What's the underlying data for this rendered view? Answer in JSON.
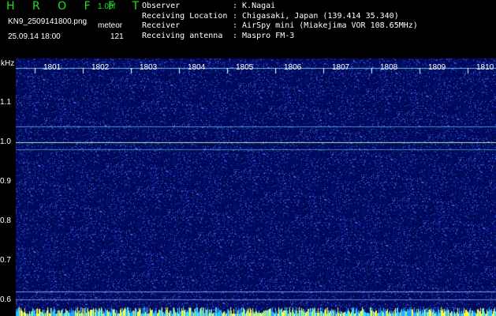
{
  "header": {
    "app": "H R O F F T",
    "version": "1.00f",
    "filename": "KN9_2509141800.png",
    "mode": "meteor",
    "datetime": "25.09.14 18:00",
    "count": "121",
    "meta": [
      {
        "key": "Observer",
        "value": ": K.Nagai"
      },
      {
        "key": "Receiving Location",
        "value": ": Chigasaki, Japan (139.414 35.340)"
      },
      {
        "key": "Receiver",
        "value": ": AirSpy mini (Miakejima VOR 108.65MHz)"
      },
      {
        "key": "Receiving antenna",
        "value": ": Maspro FM-3"
      }
    ]
  },
  "axis": {
    "unit": "kHz",
    "y_labels": [
      "1.1",
      "1.0",
      "0.9",
      "0.8",
      "0.7",
      "0.6"
    ],
    "x_labels": [
      "1801",
      "1802",
      "1803",
      "1804",
      "1805",
      "1806",
      "1807",
      "1808",
      "1809",
      "1810"
    ]
  },
  "colors": {
    "background": "#000000",
    "header_green": "#20e020",
    "spectrum_base": "#000a55",
    "noise": "#2a5cff",
    "carrier": "#7fe0ff"
  }
}
